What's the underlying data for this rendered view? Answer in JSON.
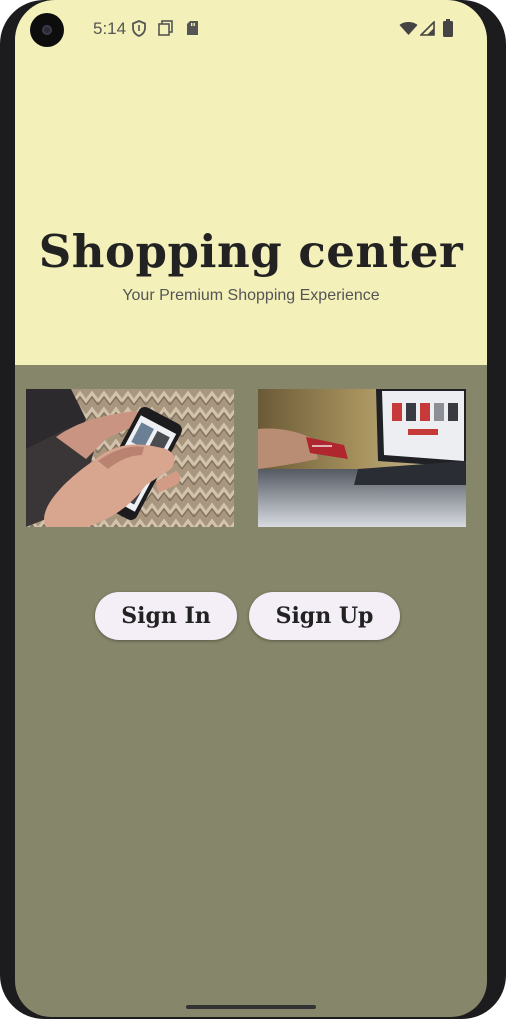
{
  "status_bar": {
    "time": "5:14",
    "left_icons": [
      "vpn-shield-icon",
      "screenshot-icon",
      "sd-card-icon"
    ],
    "right_icons": [
      "wifi-icon",
      "cell-signal-icon",
      "battery-icon"
    ]
  },
  "header": {
    "title": "Shopping center",
    "subtitle": "Your Premium Shopping Experience",
    "background": "#f3f0b9"
  },
  "images": [
    {
      "name": "phone-shopping-image",
      "description_icon": "photo"
    },
    {
      "name": "laptop-card-payment-image",
      "description_icon": "photo"
    }
  ],
  "buttons": {
    "sign_in": "Sign In",
    "sign_up": "Sign Up"
  },
  "colors": {
    "body_background": "#86866a",
    "button_background": "#f4eff7"
  }
}
